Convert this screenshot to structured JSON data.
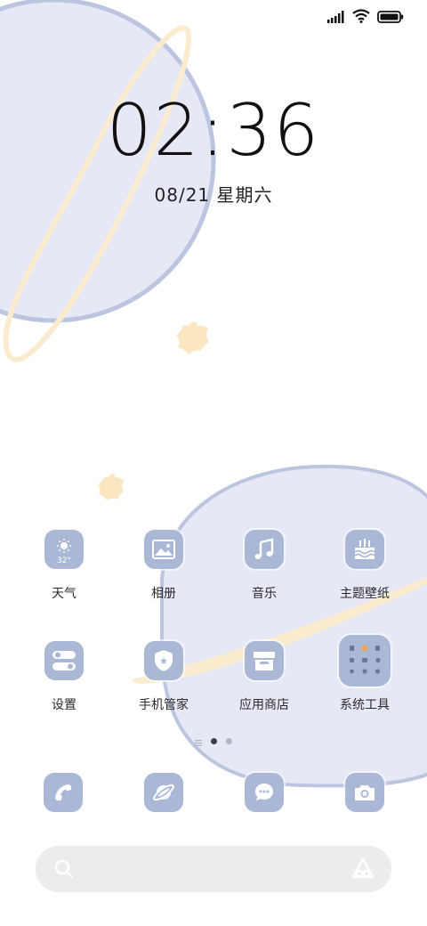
{
  "status_bar": {
    "signal_icon": "signal-bars-icon",
    "wifi_icon": "wifi-icon",
    "battery_icon": "battery-full-icon"
  },
  "lock_info": {
    "time": "02:36",
    "date": "08/21 星期六"
  },
  "apps": [
    {
      "label": "天气",
      "icon": "weather-sun-icon",
      "badge": "32°"
    },
    {
      "label": "相册",
      "icon": "gallery-icon"
    },
    {
      "label": "音乐",
      "icon": "music-note-icon"
    },
    {
      "label": "主题壁纸",
      "icon": "themes-cake-icon"
    },
    {
      "label": "设置",
      "icon": "settings-toggles-icon"
    },
    {
      "label": "手机管家",
      "icon": "security-shield-icon"
    },
    {
      "label": "应用商店",
      "icon": "app-store-icon"
    },
    {
      "label": "系统工具",
      "icon": "system-tools-folder-icon"
    }
  ],
  "page_indicator": {
    "pages": 3,
    "current": 2
  },
  "dock": [
    {
      "icon": "phone-icon"
    },
    {
      "icon": "browser-planet-icon"
    },
    {
      "icon": "messages-icon"
    },
    {
      "icon": "camera-icon"
    }
  ],
  "search": {
    "search_icon": "search-icon",
    "assistant_icon": "assistant-icon"
  },
  "colors": {
    "icon_bg": "#aab8d6",
    "planet_fill": "#e7e8f6",
    "planet_stroke": "#b9c3df",
    "ring": "#fbecd0",
    "star": "#fbe6c2",
    "search_bg": "#ececee"
  }
}
